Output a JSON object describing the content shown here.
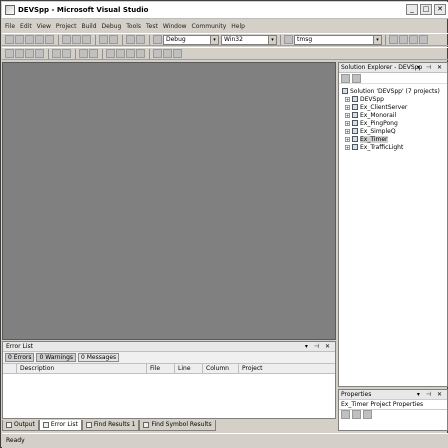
{
  "window": {
    "title": "DEVSpp - Microsoft Visual Studio"
  },
  "title_controls": {
    "minimize": "_",
    "maximize": "□",
    "close": "✕"
  },
  "menu": [
    "File",
    "Edit",
    "View",
    "Project",
    "Build",
    "Debug",
    "Tools",
    "Test",
    "Window",
    "Community",
    "Help"
  ],
  "toolbar": {
    "config_combo": "Debug",
    "platform_combo": "Win32",
    "find_combo": "tmsg"
  },
  "bottom_panel": {
    "title": "Error List",
    "filters": [
      {
        "label": "0 Errors",
        "active": true
      },
      {
        "label": "0 Warnings",
        "active": true
      },
      {
        "label": "0 Messages",
        "active": false
      }
    ],
    "columns": [
      "",
      "Description",
      "File",
      "Line",
      "Column",
      "Project"
    ]
  },
  "bottom_tabs": [
    {
      "label": "Output",
      "active": false
    },
    {
      "label": "Error List",
      "active": true
    },
    {
      "label": "Find Results 1",
      "active": false
    },
    {
      "label": "Find Symbol Results",
      "active": false
    }
  ],
  "solution_explorer": {
    "title": "Solution Explorer - DEVSpp",
    "root": "Solution 'DEVSpp' (7 projects)",
    "items": [
      {
        "label": "DEVSpp",
        "expander": "+",
        "selected": false
      },
      {
        "label": "Ex_ClientServer",
        "expander": "+",
        "selected": false
      },
      {
        "label": "Ex_Monorail",
        "expander": "+",
        "selected": false
      },
      {
        "label": "Ex_PingPong",
        "expander": "+",
        "selected": false
      },
      {
        "label": "Ex_SimpleQ",
        "expander": "+",
        "selected": false
      },
      {
        "label": "Ex_Timer",
        "expander": "+",
        "selected": true
      },
      {
        "label": "Ex_TrafficLight",
        "expander": "+",
        "selected": false
      }
    ]
  },
  "properties": {
    "title": "Properties",
    "object": "Ex_Timer Project Properties"
  },
  "panel_controls": "▾ ⊣ ✕",
  "status": {
    "text": "Ready"
  }
}
